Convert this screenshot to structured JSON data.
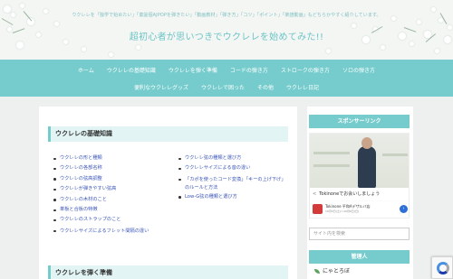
{
  "header": {
    "tagline": "ウクレレを「独学で始めたい」「童謡個AJPOPを弾きたい」「動画教材」「弾き方」「コツ」「ポイント」「楽譜動画」もどちらかやすく紹介しています。",
    "title": "超初心者が思いつきでウクレレを始めてみた!!"
  },
  "nav": {
    "row1": [
      "ホーム",
      "ウクレレの基礎知識",
      "ウクレレを弾く準備",
      "コードの弾き方",
      "ストロークの弾き方",
      "ソロの弾き方"
    ],
    "row2": [
      "便利なウクレレグッズ",
      "ウクレレで困った",
      "その他",
      "ウクレレ日記"
    ]
  },
  "main": {
    "section1_title": "ウクレレの基礎知識",
    "left_links": [
      "ウクレレの形と種類",
      "ウクレレの各部名称",
      "ウクレレの弦高調整",
      "ウクレレが弾きやすい弦高",
      "ウクレレの木材のこと",
      "単板と合板の特徴",
      "ウクレレのストラップのこと"
    ],
    "left_link_wrap": "ウクレレサイズによるフレット間隔の違い",
    "right_links": [
      "ウクレレ弦の種類と選び方",
      "ウクレレサイズによる音の違い"
    ],
    "right_link_wrap": "「カポを使ったコード変換」「キーの上げ下げ」のルールと方法",
    "right_link_last": "Low-G弦の種類と選び方",
    "section2_title": "ウクレレを弾く準備"
  },
  "sidebar": {
    "sponsor_title": "スポンサーリンク",
    "ad_caption": "Tokinoneでお会いしましょう",
    "ad_brand": "Tokinone 平和Aデザルバ店",
    "ad_dates": "10月5日(土)〜10月6日(日)",
    "ad_button": "›",
    "ad_arrow": "<",
    "search_placeholder": "サイト内を検索",
    "admin_title": "管理人",
    "profile_name": "にゃとろぼ"
  },
  "colors": {
    "accent": "#76cccd",
    "link": "#3a55b8",
    "title": "#6cc4c6"
  }
}
